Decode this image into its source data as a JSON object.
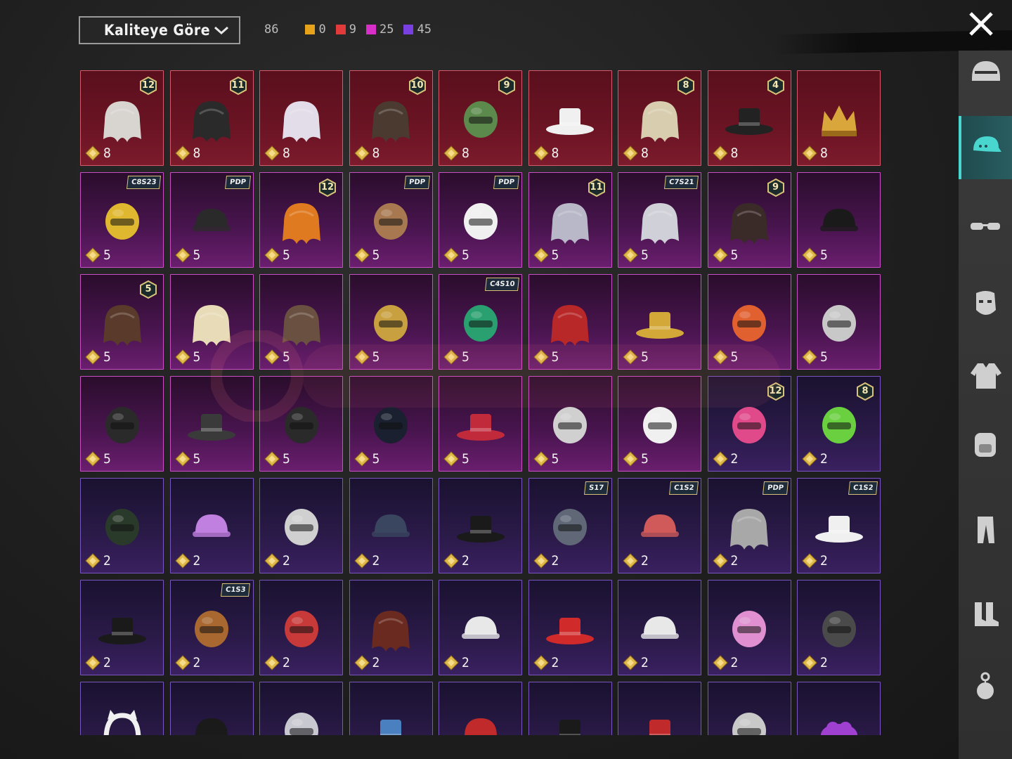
{
  "toolbar": {
    "sort_label": "Kaliteye Göre",
    "total_count": "86",
    "quality_counts": [
      {
        "color": "#e5a21a",
        "count": "0"
      },
      {
        "color": "#e03a3a",
        "count": "9"
      },
      {
        "color": "#d82fc8",
        "count": "25"
      },
      {
        "color": "#7a3fe0",
        "count": "45"
      }
    ]
  },
  "colors": {
    "accent": "#48d6cf",
    "red_quality": "#d65a6b",
    "pink_quality": "#c94fc6",
    "purple_quality": "#7a55c0"
  },
  "sidebar": {
    "categories": [
      {
        "name": "helmet-icon"
      },
      {
        "name": "cap-icon",
        "active": true
      },
      {
        "name": "glasses-icon"
      },
      {
        "name": "mask-icon"
      },
      {
        "name": "jacket-icon"
      },
      {
        "name": "backpack-icon"
      },
      {
        "name": "pants-icon"
      },
      {
        "name": "boots-icon"
      },
      {
        "name": "accessory-icon"
      }
    ]
  },
  "items": [
    {
      "q": "red",
      "price": "8",
      "level": "12",
      "art": "hair-white",
      "color": "#d8d4d0"
    },
    {
      "q": "red",
      "price": "8",
      "level": "11",
      "art": "hair-dark",
      "color": "#2a2a2a"
    },
    {
      "q": "red",
      "price": "8",
      "art": "hair-long-white",
      "color": "#e2dde8"
    },
    {
      "q": "red",
      "price": "8",
      "level": "10",
      "art": "hair-brown",
      "color": "#4a3a30"
    },
    {
      "q": "red",
      "price": "8",
      "level": "9",
      "art": "zombie-head",
      "color": "#5b8a4c"
    },
    {
      "q": "red",
      "price": "8",
      "art": "sun-hat",
      "color": "#f0f0f0"
    },
    {
      "q": "red",
      "price": "8",
      "level": "8",
      "art": "hair-blonde",
      "color": "#d9cdb0"
    },
    {
      "q": "red",
      "price": "8",
      "level": "4",
      "art": "top-hat-ball",
      "color": "#222222"
    },
    {
      "q": "red",
      "price": "8",
      "art": "crown",
      "color": "#d8a63a"
    },
    {
      "q": "pink",
      "price": "5",
      "tag": "C8S23",
      "art": "cat-headphones",
      "color": "#e0b830"
    },
    {
      "q": "pink",
      "price": "5",
      "tag": "PDP",
      "art": "cap",
      "color": "#2a2a2a"
    },
    {
      "q": "pink",
      "price": "5",
      "level": "12",
      "art": "hair-orange",
      "color": "#e07a20"
    },
    {
      "q": "pink",
      "price": "5",
      "tag": "PDP",
      "art": "llama-head",
      "color": "#a87850"
    },
    {
      "q": "pink",
      "price": "5",
      "tag": "PDP",
      "art": "panda-head",
      "color": "#f0f0f0"
    },
    {
      "q": "pink",
      "price": "5",
      "level": "11",
      "art": "hair-flowers",
      "color": "#b8b8c8"
    },
    {
      "q": "pink",
      "price": "5",
      "tag": "C7S21",
      "art": "hair-silver",
      "color": "#d0d0d8"
    },
    {
      "q": "pink",
      "price": "5",
      "level": "9",
      "art": "hair-dark-long",
      "color": "#3a2a28"
    },
    {
      "q": "pink",
      "price": "5",
      "art": "police-cap",
      "color": "#1a1a1a"
    },
    {
      "q": "pink",
      "price": "5",
      "level": "5",
      "art": "hair-bows",
      "color": "#5a3a2a"
    },
    {
      "q": "pink",
      "price": "5",
      "art": "hair-curly-blonde",
      "color": "#e8dcb8"
    },
    {
      "q": "pink",
      "price": "5",
      "art": "hair-bun",
      "color": "#6a5040"
    },
    {
      "q": "pink",
      "price": "5",
      "art": "anubis-helmet",
      "color": "#c8a040"
    },
    {
      "q": "pink",
      "price": "5",
      "tag": "C4S10",
      "art": "dragon-helmet",
      "color": "#2aa070"
    },
    {
      "q": "pink",
      "price": "5",
      "art": "hair-red",
      "color": "#b82828"
    },
    {
      "q": "pink",
      "price": "5",
      "art": "golden-hat",
      "color": "#d4a838"
    },
    {
      "q": "pink",
      "price": "5",
      "art": "orange-headgear",
      "color": "#e06030"
    },
    {
      "q": "pink",
      "price": "5",
      "art": "robot-helmet",
      "color": "#c8c8c8"
    },
    {
      "q": "pink",
      "price": "5",
      "art": "bow-headband",
      "color": "#2a2a2a"
    },
    {
      "q": "pink",
      "price": "5",
      "art": "fedora",
      "color": "#3a3a3a"
    },
    {
      "q": "pink",
      "price": "5",
      "art": "striped-helmet",
      "color": "#2a2a2a"
    },
    {
      "q": "pink",
      "price": "5",
      "art": "space-helmet",
      "color": "#1a2030"
    },
    {
      "q": "pink",
      "price": "5",
      "art": "red-top-hat",
      "color": "#c02a3a"
    },
    {
      "q": "pink",
      "price": "5",
      "art": "chicken-hood",
      "color": "#d0d0d0"
    },
    {
      "q": "pink",
      "price": "5",
      "art": "skull-mask",
      "color": "#f0f0f0"
    },
    {
      "q": "purple",
      "price": "2",
      "level": "12",
      "art": "bunny-helmet",
      "color": "#e04a8a"
    },
    {
      "q": "purple",
      "price": "2",
      "level": "8",
      "art": "green-skull-hood",
      "color": "#6ad040"
    },
    {
      "q": "purple",
      "price": "2",
      "art": "gas-mask-helmet",
      "color": "#2a3a2a"
    },
    {
      "q": "purple",
      "price": "2",
      "art": "rainbow-cap",
      "color": "#c080e0"
    },
    {
      "q": "purple",
      "price": "2",
      "art": "horned-visor",
      "color": "#d0d0d0"
    },
    {
      "q": "purple",
      "price": "2",
      "art": "beanie",
      "color": "#3a4660"
    },
    {
      "q": "purple",
      "price": "2",
      "art": "bucket-hat",
      "color": "#1a1a1a"
    },
    {
      "q": "purple",
      "price": "2",
      "tag": "S17",
      "art": "horned-helmet",
      "color": "#606878"
    },
    {
      "q": "purple",
      "price": "2",
      "tag": "C1S2",
      "art": "striped-beanie",
      "color": "#d05a5a"
    },
    {
      "q": "purple",
      "price": "2",
      "tag": "PDP",
      "art": "hair-gray-bob",
      "color": "#a8a8a8"
    },
    {
      "q": "purple",
      "price": "2",
      "tag": "C1S2",
      "art": "chef-hat",
      "color": "#f0f0f0"
    },
    {
      "q": "purple",
      "price": "2",
      "art": "witch-hat",
      "color": "#1a1a1a"
    },
    {
      "q": "purple",
      "price": "2",
      "tag": "C1S3",
      "art": "barrel-helmet",
      "color": "#a86830"
    },
    {
      "q": "purple",
      "price": "2",
      "art": "football-helmet",
      "color": "#c83a3a"
    },
    {
      "q": "purple",
      "price": "2",
      "art": "hair-bow-red",
      "color": "#6a2a20"
    },
    {
      "q": "purple",
      "price": "2",
      "art": "knit-beanie",
      "color": "#e8e8e8"
    },
    {
      "q": "purple",
      "price": "2",
      "art": "mushroom-hat",
      "color": "#d02a2a"
    },
    {
      "q": "purple",
      "price": "2",
      "art": "white-cap",
      "color": "#e8e8e8"
    },
    {
      "q": "purple",
      "price": "2",
      "art": "cat-ear-headphones",
      "color": "#e090d0"
    },
    {
      "q": "purple",
      "price": "2",
      "art": "pith-helmet",
      "color": "#4a4a4a"
    },
    {
      "q": "purple",
      "price": "",
      "art": "cat-ears",
      "color": "#f0f0f0"
    },
    {
      "q": "purple",
      "price": "",
      "art": "black-beanie",
      "color": "#1a1a1a"
    },
    {
      "q": "purple",
      "price": "",
      "art": "luchador-mask",
      "color": "#c8c8d0"
    },
    {
      "q": "purple",
      "price": "",
      "art": "shark-hat",
      "color": "#4a80c0"
    },
    {
      "q": "purple",
      "price": "",
      "art": "beret",
      "color": "#c02a2a"
    },
    {
      "q": "purple",
      "price": "",
      "art": "black-fedora",
      "color": "#1a1a1a"
    },
    {
      "q": "purple",
      "price": "",
      "art": "red-hat",
      "color": "#c02a2a"
    },
    {
      "q": "purple",
      "price": "",
      "art": "shark-head",
      "color": "#c8c8c8"
    },
    {
      "q": "purple",
      "price": "",
      "art": "purple-flowers",
      "color": "#a040d0"
    }
  ]
}
